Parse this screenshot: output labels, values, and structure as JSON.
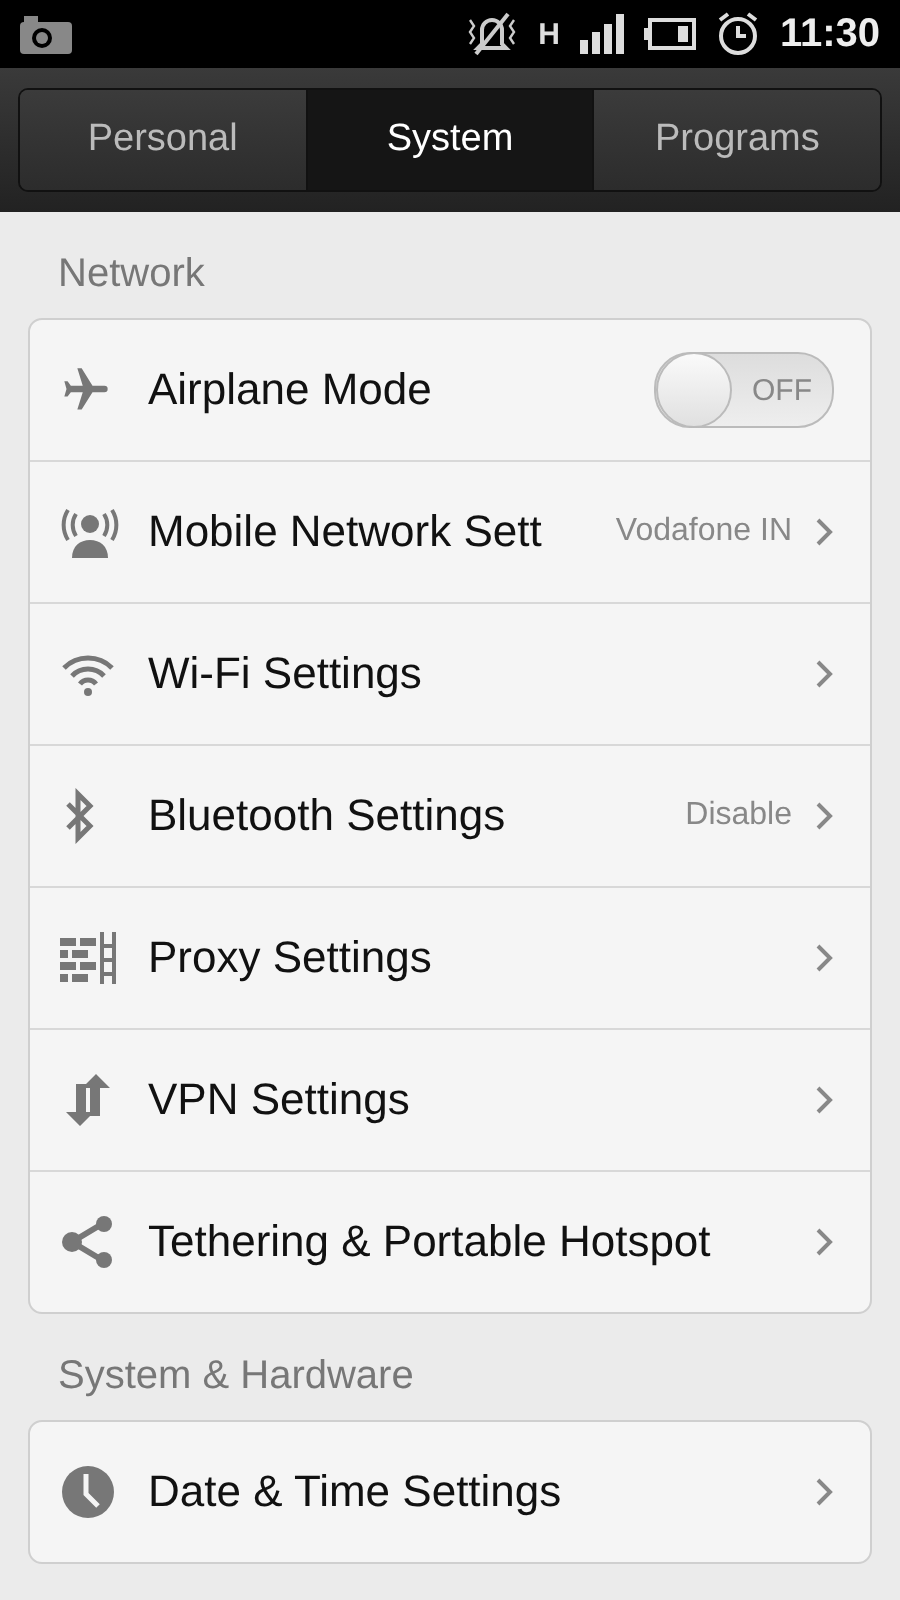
{
  "status_bar": {
    "network_type": "H",
    "time": "11:30"
  },
  "tabs": [
    {
      "label": "Personal",
      "selected": false
    },
    {
      "label": "System",
      "selected": true
    },
    {
      "label": "Programs",
      "selected": false
    }
  ],
  "sections": [
    {
      "title": "Network",
      "rows": [
        {
          "kind": "toggle",
          "label": "Airplane Mode",
          "on": false,
          "state_label": "OFF"
        },
        {
          "kind": "link",
          "label": "Mobile Network Sett",
          "value": "Vodafone IN"
        },
        {
          "kind": "link",
          "label": "Wi-Fi Settings"
        },
        {
          "kind": "link",
          "label": "Bluetooth Settings",
          "value": "Disable"
        },
        {
          "kind": "link",
          "label": "Proxy Settings"
        },
        {
          "kind": "link",
          "label": "VPN Settings"
        },
        {
          "kind": "link",
          "label": "Tethering & Portable Hotspot"
        }
      ]
    },
    {
      "title": "System & Hardware",
      "rows": [
        {
          "kind": "link",
          "label": "Date & Time Settings"
        }
      ]
    }
  ]
}
